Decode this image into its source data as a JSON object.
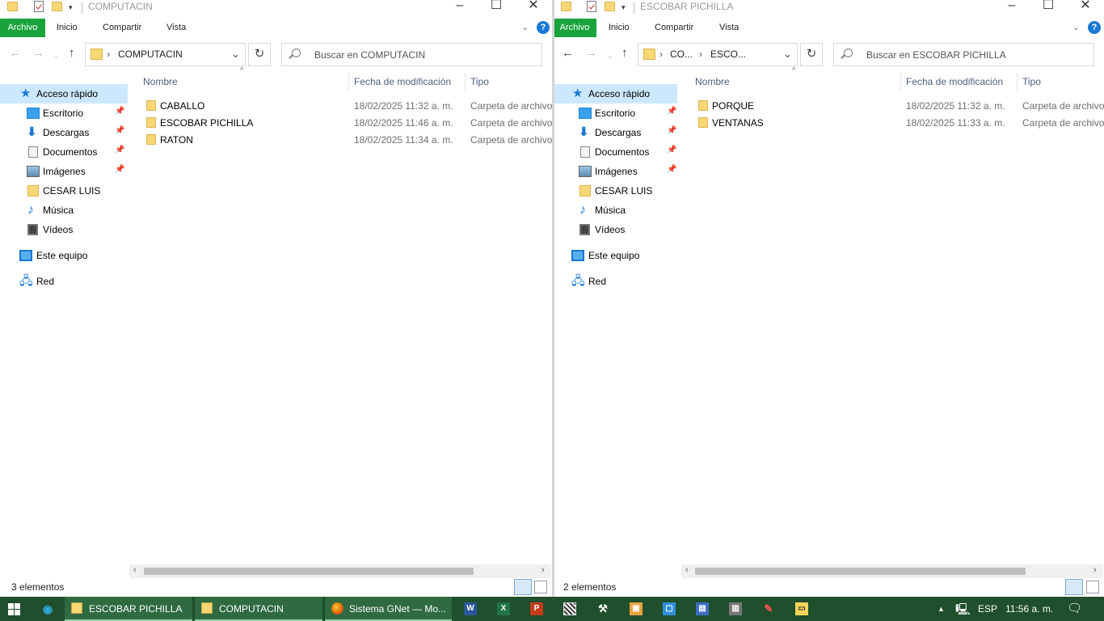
{
  "left": {
    "title": "COMPUTACIN",
    "tabs": {
      "archivo": "Archivo",
      "inicio": "Inicio",
      "compartir": "Compartir",
      "vista": "Vista"
    },
    "breadcrumb": [
      "COMPUTACIN"
    ],
    "search_placeholder": "Buscar en COMPUTACIN",
    "columns": {
      "name": "Nombre",
      "date": "Fecha de modificación",
      "type": "Tipo"
    },
    "files": [
      {
        "name": "CABALLO",
        "date": "18/02/2025 11:32 a. m.",
        "type": "Carpeta de archivos"
      },
      {
        "name": "ESCOBAR PICHILLA",
        "date": "18/02/2025 11:46 a. m.",
        "type": "Carpeta de archivos"
      },
      {
        "name": "RATON",
        "date": "18/02/2025 11:34 a. m.",
        "type": "Carpeta de archivos"
      }
    ],
    "status": "3 elementos"
  },
  "right": {
    "title": "ESCOBAR PICHILLA",
    "tabs": {
      "archivo": "Archivo",
      "inicio": "Inicio",
      "compartir": "Compartir",
      "vista": "Vista"
    },
    "breadcrumb": [
      "CO...",
      "ESCO..."
    ],
    "search_placeholder": "Buscar en ESCOBAR PICHILLA",
    "columns": {
      "name": "Nombre",
      "date": "Fecha de modificación",
      "type": "Tipo"
    },
    "files": [
      {
        "name": "PORQUE",
        "date": "18/02/2025 11:32 a. m.",
        "type": "Carpeta de archivos"
      },
      {
        "name": "VENTANAS",
        "date": "18/02/2025 11:33 a. m.",
        "type": "Carpeta de archivos"
      }
    ],
    "status": "2 elementos"
  },
  "sidebar": {
    "quick_access": "Acceso rápido",
    "items": [
      "Escritorio",
      "Descargas",
      "Documentos",
      "Imágenes",
      "CESAR LUIS",
      "Música",
      "Vídeos"
    ],
    "this_pc": "Este equipo",
    "network": "Red"
  },
  "taskbar": {
    "apps": [
      "ESCOBAR PICHILLA",
      "COMPUTACIN",
      "Sistema GNet — Mo..."
    ],
    "language": "ESP",
    "time": "11:56 a. m."
  },
  "colors": {
    "accent_green": "#19a33c",
    "taskbar": "#1f4f2d",
    "selection": "#cce8ff"
  }
}
